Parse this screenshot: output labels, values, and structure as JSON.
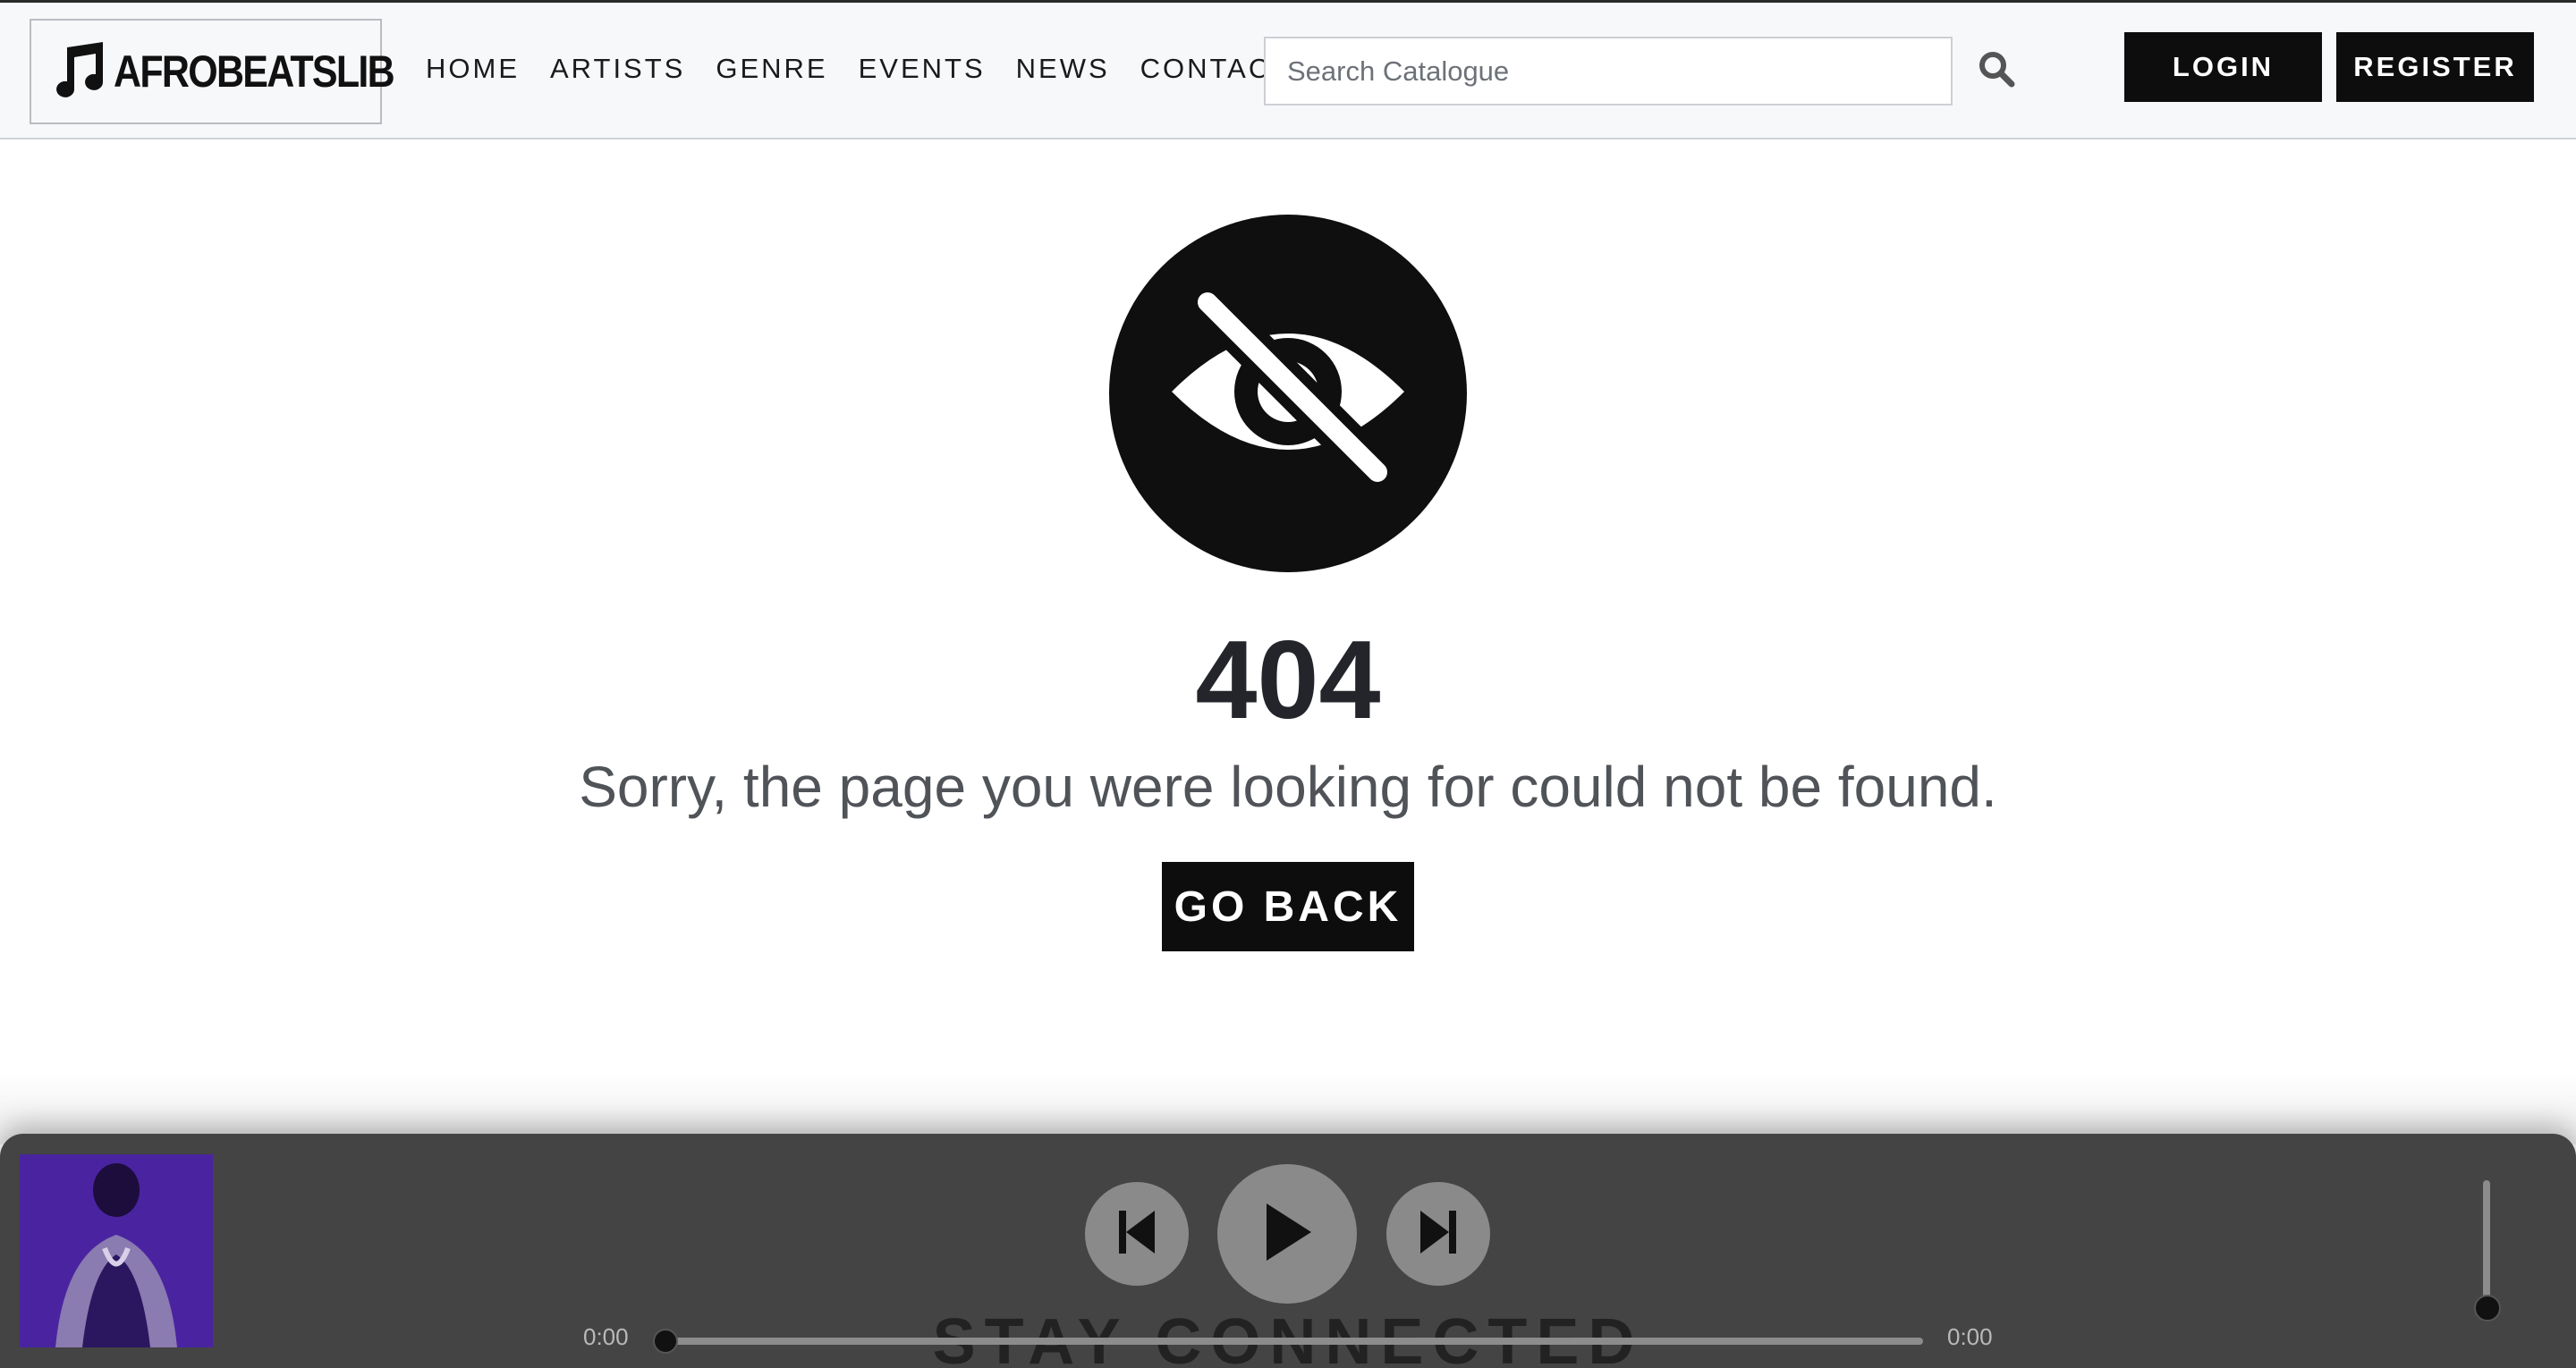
{
  "header": {
    "logo_text": "AFROBEATSLIB",
    "logo_icon": "music-note-icon",
    "nav": [
      {
        "label": "HOME"
      },
      {
        "label": "ARTISTS"
      },
      {
        "label": "GENRE"
      },
      {
        "label": "EVENTS"
      },
      {
        "label": "NEWS"
      },
      {
        "label": "CONTACT"
      }
    ],
    "search": {
      "placeholder": "Search Catalogue",
      "value": "",
      "icon": "search-icon"
    },
    "login_label": "LOGIN",
    "register_label": "REGISTER"
  },
  "main": {
    "icon": "eye-slash-icon",
    "code": "404",
    "message": "Sorry, the page you were looking for could not be found.",
    "go_back_label": "GO BACK"
  },
  "footer": {
    "section_title": "STAY CONNECTED"
  },
  "player": {
    "current_time": "0:00",
    "duration": "0:00",
    "progress": 0,
    "volume": 0,
    "controls": [
      "previous-icon",
      "play-icon",
      "next-icon"
    ]
  },
  "colors": {
    "primary_dark": "#0d0d0d",
    "header_bg": "#f7f8fa",
    "player_bg": "#444444",
    "text_heading": "#23252a",
    "text_body": "#505358"
  }
}
